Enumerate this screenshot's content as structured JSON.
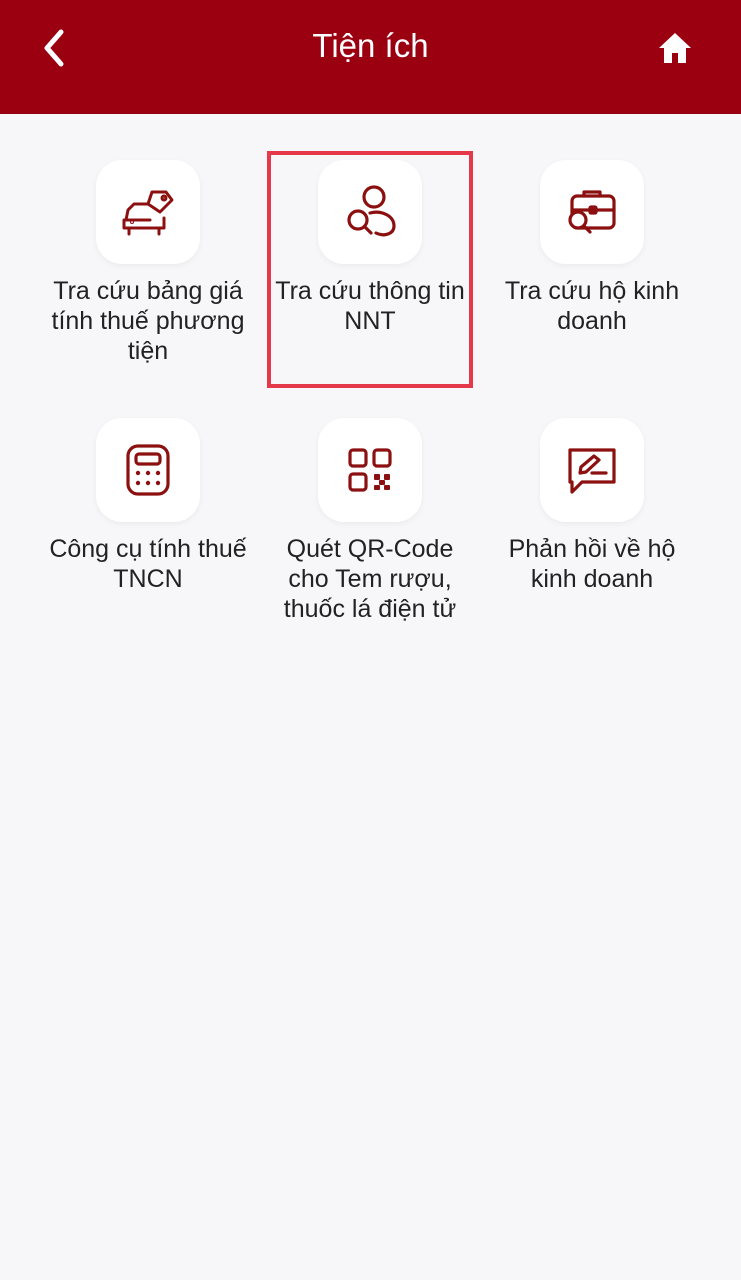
{
  "header": {
    "title": "Tiện ích",
    "back_icon": "chevron-left-icon",
    "home_icon": "home-icon",
    "background": "#9b0011"
  },
  "tiles": [
    {
      "label": "Tra cứu bảng giá tính thuế phương tiện",
      "icon": "car-price-tag-icon"
    },
    {
      "label": "Tra cứu thông tin NNT",
      "icon": "person-search-icon",
      "highlighted": true
    },
    {
      "label": "Tra cứu hộ kinh doanh",
      "icon": "briefcase-search-icon"
    },
    {
      "label": "Công cụ tính thuế TNCN",
      "icon": "calculator-icon"
    },
    {
      "label": "Quét QR-Code cho Tem rượu, thuốc lá điện tử",
      "icon": "qr-code-icon"
    },
    {
      "label": "Phản hồi về hộ kinh doanh",
      "icon": "feedback-edit-icon"
    }
  ],
  "colors": {
    "accent": "#9b0011",
    "icon": "#8c1010",
    "highlight_border": "#e5394b"
  }
}
